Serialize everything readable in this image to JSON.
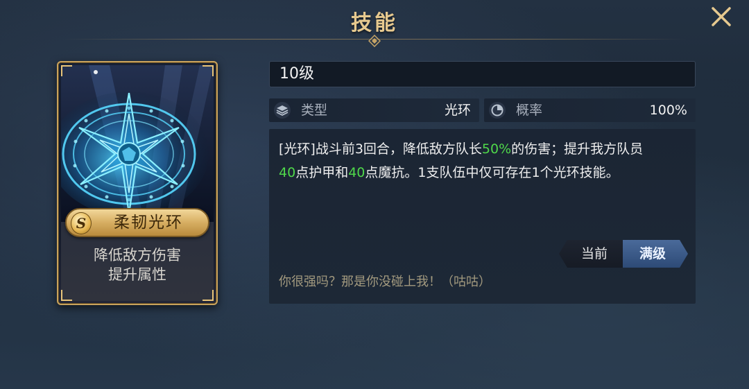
{
  "header": {
    "title": "技能"
  },
  "card": {
    "grade": "S",
    "skill_name": "柔韧光环",
    "desc_line1": "降低敌方伤害",
    "desc_line2": "提升属性"
  },
  "detail": {
    "level": "10级",
    "type_label": "类型",
    "type_value": "光环",
    "prob_label": "概率",
    "prob_value": "100%",
    "description": {
      "seg1": "[光环]战斗前3回合，降低敌方队长",
      "hl1": "50%",
      "seg2": "的伤害；提升我方队员",
      "hl2": "40",
      "seg3": "点护甲和",
      "hl3": "40",
      "seg4": "点魔抗。1支队伍中仅可存在1个光环技能。"
    },
    "toggle_current": "当前",
    "toggle_max": "满级",
    "quote": "你很强吗？那是你没碰上我！（咕咕）"
  },
  "colors": {
    "gold": "#e6c98f",
    "highlight_green": "#4fd84a",
    "active_tab": "#3a5a8a"
  },
  "icons": {
    "close": "close-icon",
    "type": "layers-icon",
    "probability": "pie-chart-icon"
  }
}
